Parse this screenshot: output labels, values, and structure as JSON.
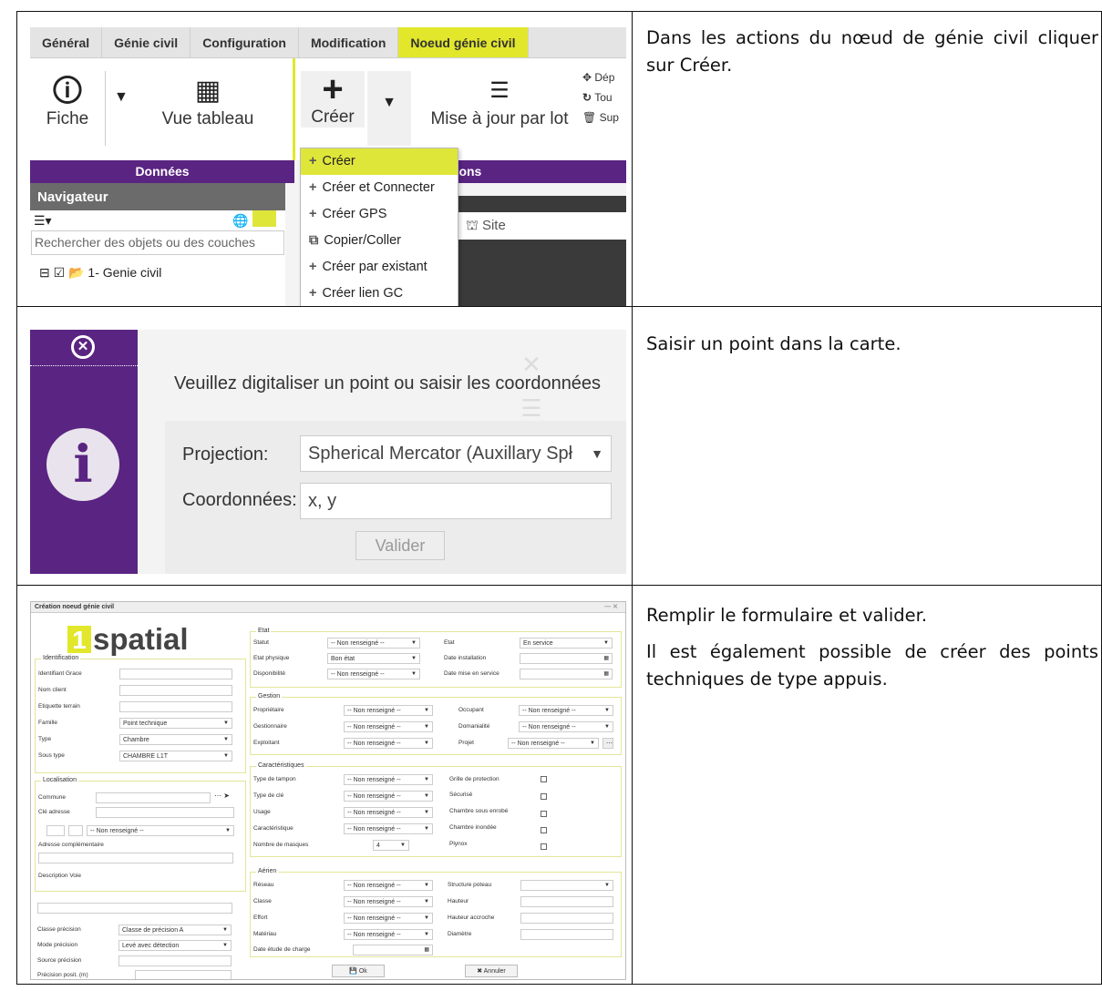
{
  "row1": {
    "tabs": [
      "Général",
      "Génie civil",
      "Configuration",
      "Modification",
      "Noeud génie civil"
    ],
    "buttons": {
      "fiche": "Fiche",
      "vue": "Vue tableau",
      "creer": "Créer",
      "mise": "Mise à jour par lot"
    },
    "side": [
      "Dép",
      "Tou",
      "Sup"
    ],
    "groups": {
      "donnees": "Données",
      "actions": "Actions"
    },
    "nav_title": "Navigateur",
    "search_placeholder": "Rechercher des objets ou des couches",
    "tree_item": "1- Genie civil",
    "site": "Site",
    "menu": [
      "Créer",
      "Créer et Connecter",
      "Créer GPS",
      "Copier/Coller",
      "Créer par existant",
      "Créer lien GC"
    ],
    "desc": "Dans les actions du nœud de génie civil cliquer sur Créer."
  },
  "row2": {
    "instruction": "Veuillez digitaliser un point ou saisir les coordonnées",
    "projection_label": "Projection:",
    "projection_value": "Spherical Mercator (Auxillary Spł",
    "coord_label": "Coordonnées:",
    "coord_placeholder": "x, y",
    "validate": "Valider",
    "desc": "Saisir un point dans la carte."
  },
  "row3": {
    "title": "Création noeud génie civil",
    "logo_num": "1",
    "logo_text": "spatial",
    "identification": {
      "legend": "Identification",
      "labels": [
        "Identifiant Grace",
        "Nom client",
        "Etiquette terrain",
        "Famille",
        "Type",
        "Sous type"
      ],
      "values": [
        "",
        "",
        "",
        "Point technique",
        "Chambre",
        "CHAMBRE L1T"
      ]
    },
    "localisation": {
      "legend": "Localisation",
      "commune": "Commune",
      "cle": "Clé adresse",
      "nr": "-- Non renseigné --",
      "adr": "Adresse complémentaire",
      "voie": "Description Voie"
    },
    "precision": {
      "labels": [
        "Classe précision",
        "Mode précision",
        "Source précision",
        "Précision posit. (m)"
      ],
      "values": [
        "Classe de précision A",
        "Levé avec détection",
        "",
        ""
      ]
    },
    "etat": {
      "legend": "Etat",
      "statut": "Statut",
      "statut_v": "-- Non renseigné --",
      "etat": "Etat",
      "etat_v": "En service",
      "physique": "Etat physique",
      "physique_v": "Bon état",
      "date_inst": "Date installation",
      "dispo": "Disponibilité",
      "dispo_v": "-- Non renseigné --",
      "date_mise": "Date mise en service"
    },
    "gestion": {
      "legend": "Gestion",
      "left": [
        "Propriétaire",
        "Gestionnaire",
        "Exploitant"
      ],
      "right": [
        "Occupant",
        "Domanialité",
        "Projet"
      ],
      "nr": "-- Non renseigné --"
    },
    "carac": {
      "legend": "Caractéristiques",
      "left": [
        "Type de tampon",
        "Type de clé",
        "Usage",
        "Caractéristique",
        "Nombre de masques"
      ],
      "right": [
        "Grille de protection",
        "Sécurisé",
        "Chambre sous enrobé",
        "Chambre inondée",
        "Plynox"
      ],
      "masques": "4",
      "nr": "-- Non renseigné --"
    },
    "aerien": {
      "legend": "Aérien",
      "left": [
        "Réseau",
        "Classe",
        "Effort",
        "Matériau",
        "Date étude de charge"
      ],
      "right": [
        "Structure poteau",
        "Hauteur",
        "Hauteur accroche",
        "Diamètre"
      ],
      "nr": "-- Non renseigné --"
    },
    "ok": "Ok",
    "cancel": "Annuler",
    "desc1": "Remplir le formulaire et valider.",
    "desc2": "Il est également possible de créer des points techniques de type appuis."
  }
}
